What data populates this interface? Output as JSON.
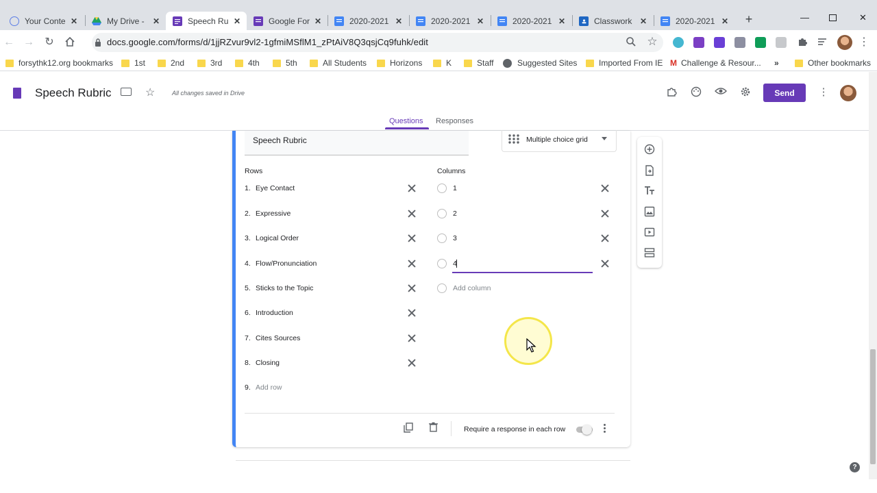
{
  "browser": {
    "tabs": [
      {
        "title": "Your Conte",
        "icon": "content-icon",
        "color": "#5b7de6"
      },
      {
        "title": "My Drive -",
        "icon": "drive-icon",
        "color": "#1fa463"
      },
      {
        "title": "Speech Ru",
        "icon": "forms-icon",
        "color": "#673ab7",
        "active": true
      },
      {
        "title": "Google For",
        "icon": "forms-icon",
        "color": "#673ab7"
      },
      {
        "title": "2020-2021",
        "icon": "docs-icon",
        "color": "#4285f4"
      },
      {
        "title": "2020-2021",
        "icon": "docs-icon",
        "color": "#4285f4"
      },
      {
        "title": "2020-2021",
        "icon": "docs-icon",
        "color": "#4285f4"
      },
      {
        "title": "Classwork",
        "icon": "classroom-icon",
        "color": "#1e66c2"
      },
      {
        "title": "2020-2021",
        "icon": "docs-icon",
        "color": "#4285f4"
      }
    ],
    "url": "docs.google.com/forms/d/1jjRZvur9vl2-1gfmiMSflM1_zPtAiV8Q3qsjCq9fuhk/edit",
    "bookmarks": [
      {
        "label": "forsythk12.org bookmarks",
        "icon": "folder-icon"
      },
      {
        "label": "1st",
        "icon": "folder-icon"
      },
      {
        "label": "2nd",
        "icon": "folder-icon"
      },
      {
        "label": "3rd",
        "icon": "folder-icon"
      },
      {
        "label": "4th",
        "icon": "folder-icon"
      },
      {
        "label": "5th",
        "icon": "folder-icon"
      },
      {
        "label": "All Students",
        "icon": "folder-icon"
      },
      {
        "label": "Horizons",
        "icon": "folder-icon"
      },
      {
        "label": "K",
        "icon": "folder-icon"
      },
      {
        "label": "Staff",
        "icon": "folder-icon"
      },
      {
        "label": "Suggested Sites",
        "icon": "globe-icon"
      },
      {
        "label": "Imported From IE",
        "icon": "folder-icon"
      },
      {
        "label": "Challenge & Resour...",
        "icon": "link-icon"
      },
      {
        "label": "»",
        "icon": "more-bookmarks-icon"
      },
      {
        "label": "Other bookmarks",
        "icon": "folder-icon"
      }
    ]
  },
  "form": {
    "title": "Speech Rubric",
    "save_status": "All changes saved in Drive",
    "send_label": "Send",
    "tabs": {
      "questions": "Questions",
      "responses": "Responses"
    },
    "accent": "#673ab7",
    "question": {
      "title": "Speech Rubric",
      "type": "Multiple choice grid",
      "rows_heading": "Rows",
      "columns_heading": "Columns",
      "rows": [
        {
          "num": "1.",
          "label": "Eye Contact"
        },
        {
          "num": "2.",
          "label": "Expressive"
        },
        {
          "num": "3.",
          "label": "Logical Order"
        },
        {
          "num": "4.",
          "label": "Flow/Pronunciation"
        },
        {
          "num": "5.",
          "label": "Sticks to the Topic"
        },
        {
          "num": "6.",
          "label": "Introduction"
        },
        {
          "num": "7.",
          "label": "Cites Sources"
        },
        {
          "num": "8.",
          "label": "Closing"
        }
      ],
      "add_row": {
        "num": "9.",
        "label": "Add row"
      },
      "columns": [
        "1",
        "2",
        "3",
        "4"
      ],
      "add_column": "Add column",
      "require_label": "Require a response in each row"
    }
  }
}
